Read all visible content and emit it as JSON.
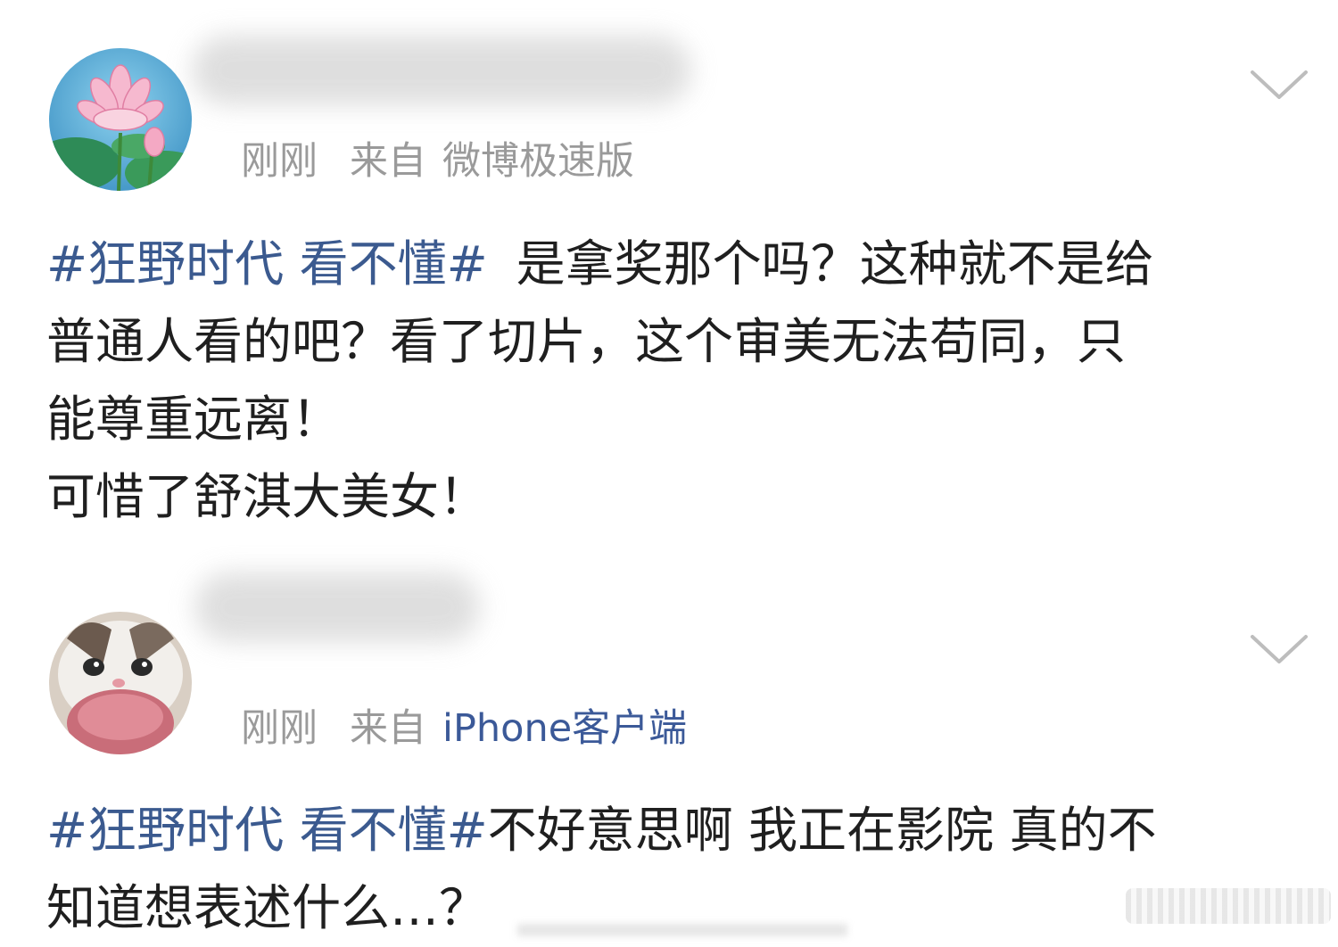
{
  "posts": [
    {
      "time": "刚刚",
      "from_label": "来自",
      "source": "微博极速版",
      "topic": "#狂野时代 看不懂#",
      "text_lines": [
        "是拿奖那个吗？这种就不是给",
        "普通人看的吧？看了切片，这个审美无法苟同，只",
        "能尊重远离！",
        "可惜了舒淇大美女！"
      ],
      "avatar_icon": "lotus-avatar-icon",
      "menu_icon": "chevron-down-icon"
    },
    {
      "time": "刚刚",
      "from_label": "来自",
      "source": "iPhone客户端",
      "topic": "#狂野时代 看不懂#",
      "text_lines": [
        "不好意思啊 我正在影院 真的不",
        "知道想表述什么…？"
      ],
      "avatar_icon": "cat-avatar-icon",
      "menu_icon": "chevron-down-icon"
    }
  ],
  "colors": {
    "topic": "#3b5a8f",
    "source_link": "#3b5998",
    "meta": "#9a9a9a",
    "text": "#1f1f1f"
  }
}
